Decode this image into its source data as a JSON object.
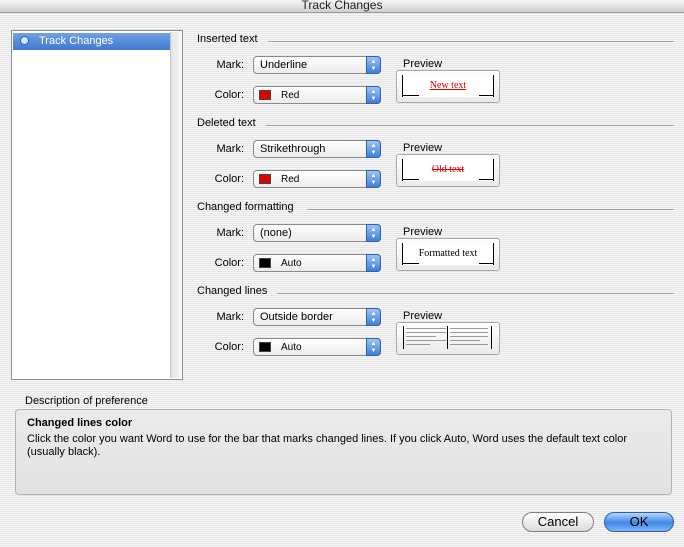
{
  "window": {
    "title": "Track Changes"
  },
  "sidebar": {
    "items": [
      {
        "label": "Track Changes",
        "selected": true
      }
    ]
  },
  "labels": {
    "mark": "Mark:",
    "color": "Color:",
    "preview": "Preview"
  },
  "sections": {
    "inserted": {
      "title": "Inserted text",
      "mark_value": "Underline",
      "color_value": "Red",
      "swatch": "#e00000",
      "preview_text": "New text"
    },
    "deleted": {
      "title": "Deleted text",
      "mark_value": "Strikethrough",
      "color_value": "Red",
      "swatch": "#e00000",
      "preview_text": "Old text"
    },
    "formatting": {
      "title": "Changed formatting",
      "mark_value": "(none)",
      "color_value": "Auto",
      "swatch": "#000000",
      "preview_text": "Formatted text"
    },
    "lines": {
      "title": "Changed lines",
      "mark_value": "Outside border",
      "color_value": "Auto",
      "swatch": "#000000"
    }
  },
  "description": {
    "label": "Description of preference",
    "title": "Changed lines color",
    "text": "Click the color you want Word to use for the bar that marks changed lines. If you click Auto, Word uses the default text color (usually black)."
  },
  "buttons": {
    "cancel": "Cancel",
    "ok": "OK"
  },
  "colors": {
    "accent": "#3f78d0",
    "red": "#e00000"
  }
}
